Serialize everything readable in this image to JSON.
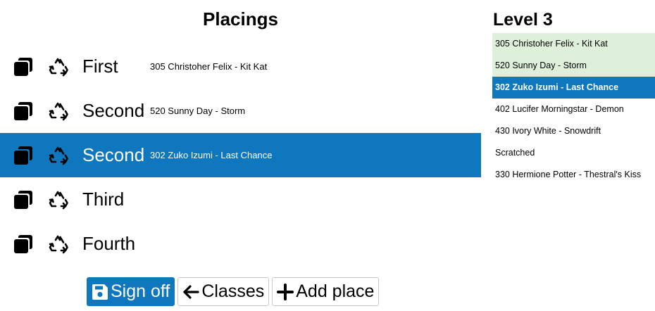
{
  "placings": {
    "title": "Placings",
    "rows": [
      {
        "place": "First",
        "entry": "305 Christoher Felix - Kit Kat",
        "selected": false
      },
      {
        "place": "Second",
        "entry": "520 Sunny Day - Storm",
        "selected": false
      },
      {
        "place": "Second",
        "entry": "302 Zuko Izumi - Last Chance",
        "selected": true
      },
      {
        "place": "Third",
        "entry": "",
        "selected": false
      },
      {
        "place": "Fourth",
        "entry": "",
        "selected": false
      }
    ],
    "row_icons": {
      "copy": "copy-icon",
      "recycle": "recycle-icon"
    }
  },
  "buttons": {
    "sign_off": {
      "label": "Sign off",
      "icon": "save-icon"
    },
    "classes": {
      "label": "Classes",
      "icon": "arrow-left-icon"
    },
    "add_place": {
      "label": "Add place",
      "icon": "plus-icon"
    }
  },
  "level": {
    "title": "Level 3",
    "items": [
      {
        "label": "305 Christoher Felix - Kit Kat",
        "state": "entered"
      },
      {
        "label": "520 Sunny Day - Storm",
        "state": "entered"
      },
      {
        "label": "302 Zuko Izumi - Last Chance",
        "state": "selected"
      },
      {
        "label": "402 Lucifer Morningstar - Demon",
        "state": "none"
      },
      {
        "label": "430 Ivory White - Snowdrift",
        "state": "none"
      },
      {
        "label": "Scratched",
        "state": "none"
      },
      {
        "label": "330 Hermione Potter - Thestral's Kiss",
        "state": "none"
      }
    ]
  },
  "colors": {
    "accent": "#0f77bd",
    "entered_highlight": "#def0da"
  }
}
